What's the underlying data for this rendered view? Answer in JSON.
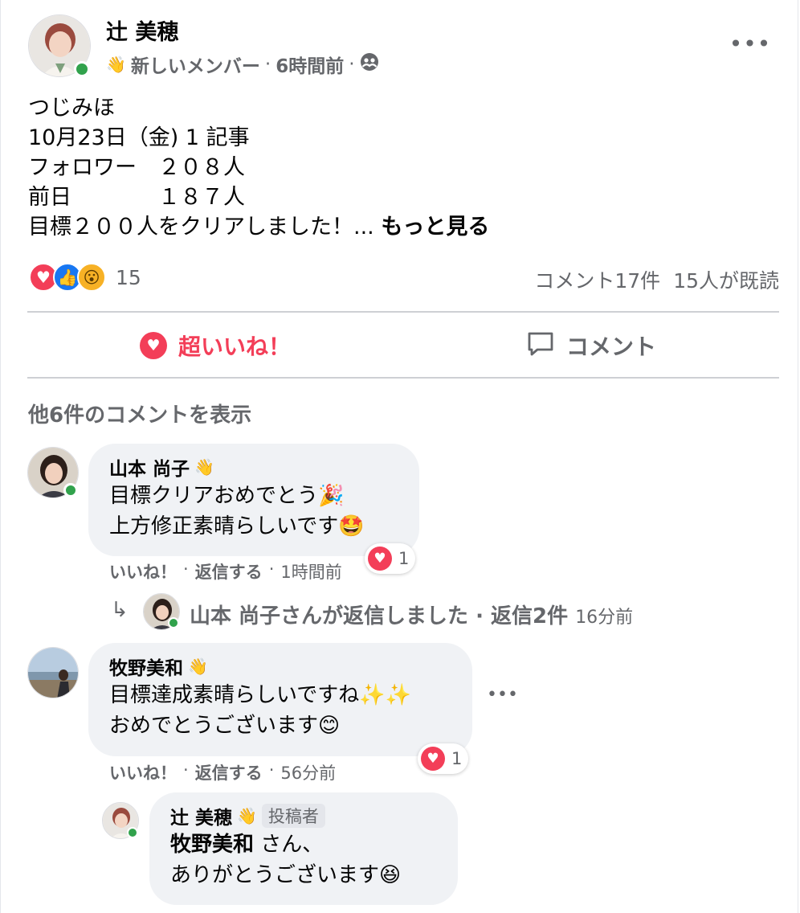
{
  "post": {
    "author": "辻 美穂",
    "badge": "新しいメンバー",
    "time": "6時間前",
    "body_lines": [
      "つじみほ",
      "10月23日（金) 1 記事",
      "フォロワー　２０８人",
      "前日　　　　１８７人",
      "目標２００人をクリアしました！..."
    ],
    "see_more": "もっと見る",
    "reaction_count": "15",
    "comment_count": "コメント17件",
    "seen_count": "15人が既読",
    "like_button": "超いいね！",
    "comment_button": "コメント",
    "view_more_comments": "他6件のコメントを表示"
  },
  "comments": [
    {
      "name": "山本 尚子",
      "lines": [
        "目標クリアおめでとう🎉",
        "上方修正素晴らしいです🤩"
      ],
      "like": "いいね！",
      "reply": "返信する",
      "time": "1時間前",
      "reactions": "1",
      "replies_summary": "山本 尚子さんが返信しました · 返信2件",
      "replies_time": "16分前"
    },
    {
      "name": "牧野美和",
      "lines": [
        "目標達成素晴らしいですね✨✨",
        "おめでとうございます😊"
      ],
      "like": "いいね！",
      "reply": "返信する",
      "time": "56分前",
      "reactions": "1"
    }
  ],
  "reply": {
    "name": "辻 美穂",
    "tag": "投稿者",
    "mention": "牧野美和",
    "line1_rest": " さん、",
    "line2": "ありがとうございます😆"
  },
  "colors": {
    "love": "#f33e58",
    "like_blue": "#1877f2",
    "online": "#31a24c",
    "bubble": "#f0f2f5",
    "secondary_text": "#65676b"
  }
}
